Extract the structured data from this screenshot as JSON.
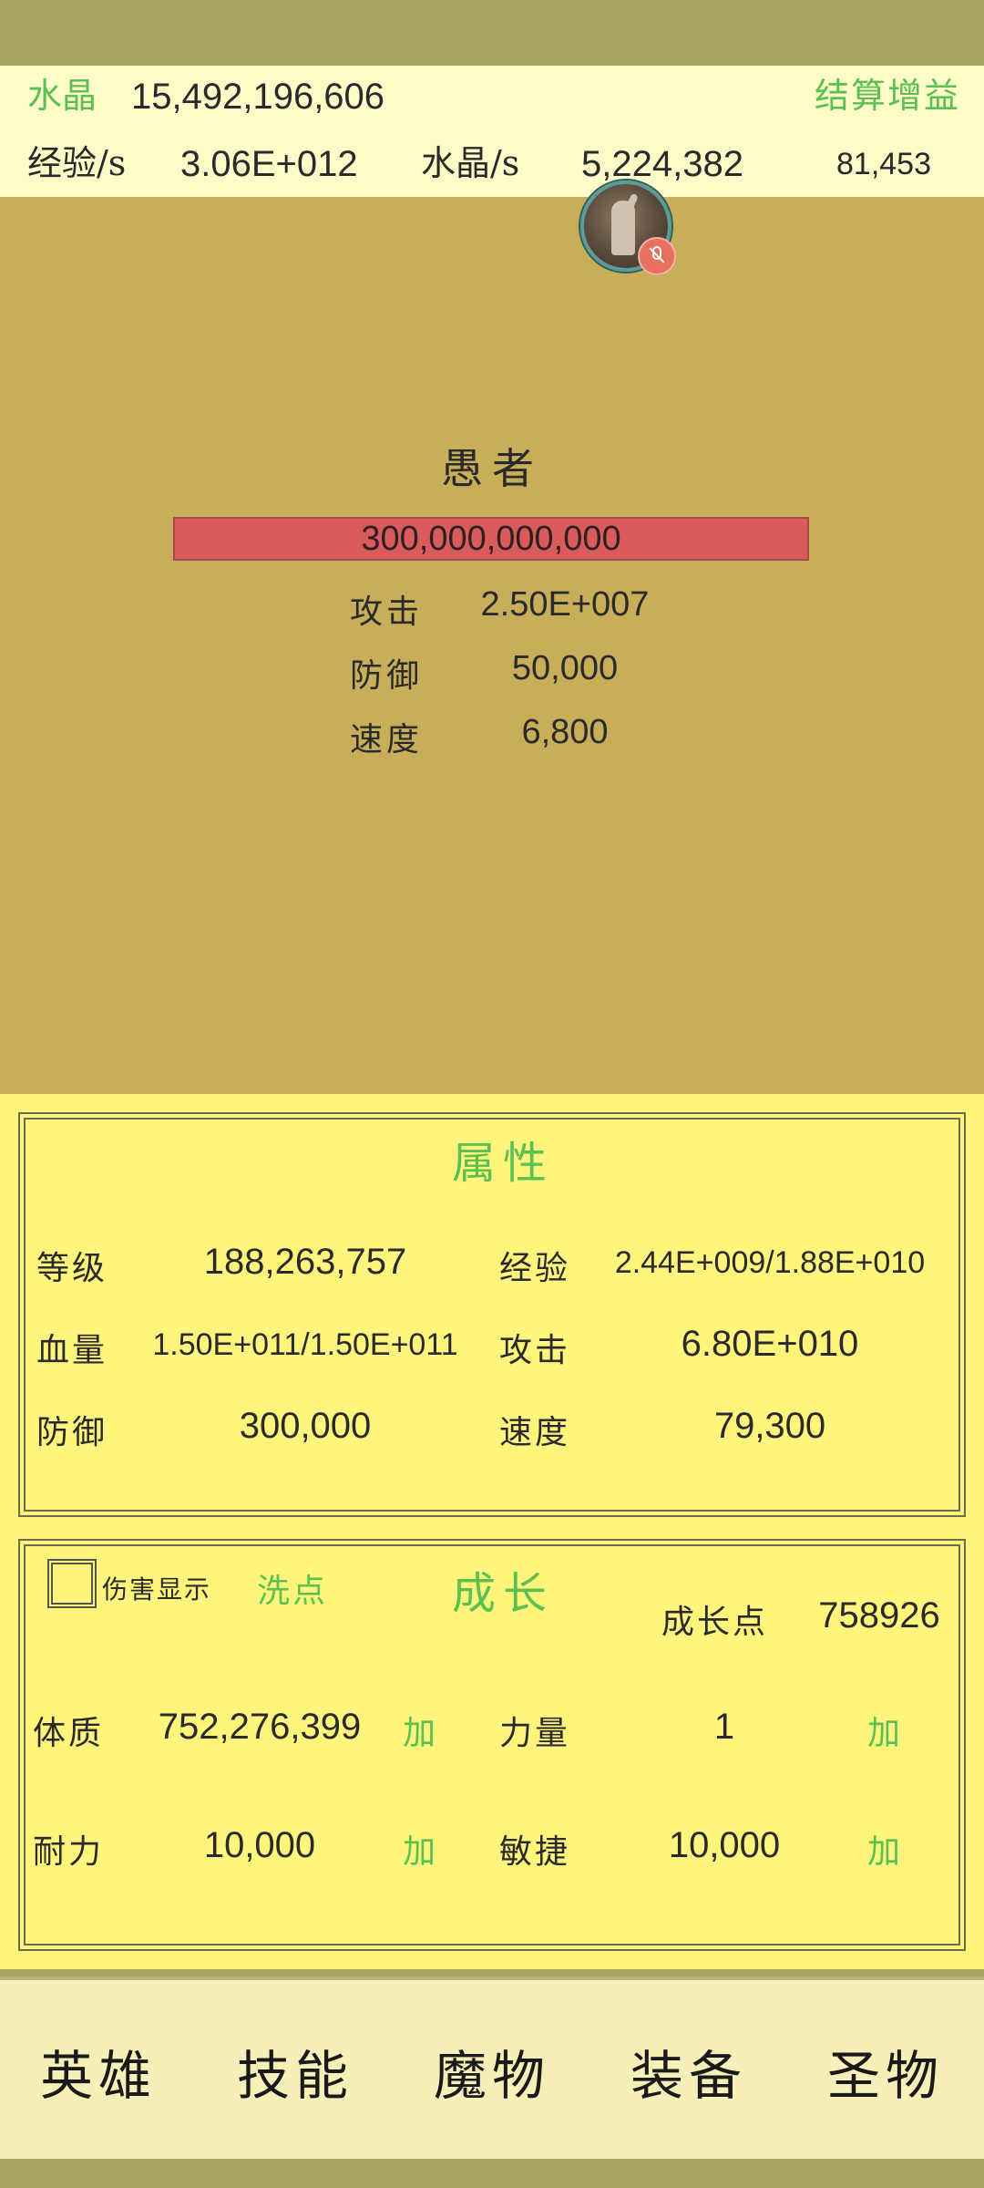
{
  "header": {
    "crystal_label": "水晶",
    "crystal_value": "15,492,196,606",
    "settle_bonus": "结算增益",
    "exp_rate_label": "经验/s",
    "exp_rate_value": "3.06E+012",
    "crystal_rate_label": "水晶/s",
    "crystal_rate_value": "5,224,382",
    "extra_value": "81,453"
  },
  "enemy": {
    "name": "愚者",
    "hp": "300,000,000,000",
    "hp_fraction": 1.0,
    "stats": [
      {
        "label": "攻击",
        "value": "2.50E+007"
      },
      {
        "label": "防御",
        "value": "50,000"
      },
      {
        "label": "速度",
        "value": "6,800"
      }
    ]
  },
  "attributes": {
    "title": "属性",
    "level_label": "等级",
    "level_value": "188,263,757",
    "exp_label": "经验",
    "exp_value": "2.44E+009/1.88E+010",
    "hp_label": "血量",
    "hp_value": "1.50E+011/1.50E+011",
    "atk_label": "攻击",
    "atk_value": "6.80E+010",
    "def_label": "防御",
    "def_value": "300,000",
    "spd_label": "速度",
    "spd_value": "79,300"
  },
  "growth": {
    "damage_display_label": "伤害显示",
    "damage_display_checked": false,
    "wash_points": "洗点",
    "title": "成长",
    "points_label": "成长点",
    "points_value": "758926",
    "add_label": "加",
    "constitution_label": "体质",
    "constitution_value": "752,276,399",
    "strength_label": "力量",
    "strength_value": "1",
    "endurance_label": "耐力",
    "endurance_value": "10,000",
    "agility_label": "敏捷",
    "agility_value": "10,000"
  },
  "nav": [
    "英雄",
    "技能",
    "魔物",
    "装备",
    "圣物"
  ],
  "colors": {
    "accent_green": "#5bbf52",
    "battle_bg": "#c8ae58",
    "panel_bg": "#fff57c",
    "hp_bar": "#d95b5b"
  }
}
